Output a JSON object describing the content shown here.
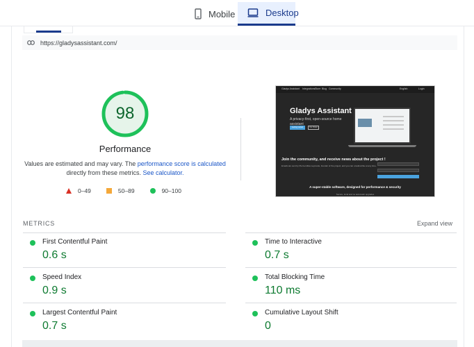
{
  "device_tabs": {
    "mobile": "Mobile",
    "desktop": "Desktop",
    "active": "desktop"
  },
  "url": "https://gladysassistant.com/",
  "score": {
    "value": 98,
    "value_fraction": 0.98,
    "label": "Performance",
    "color": "#0d652d",
    "ring_color": "#1ec15a",
    "ring_bg": "#e6f4ea"
  },
  "description": {
    "part1": "Values are estimated and may vary. The ",
    "link1": "performance score is calculated",
    "part2": " directly from these metrics. ",
    "link2": "See calculator."
  },
  "legend": [
    {
      "shape": "triangle",
      "color": "#d93025",
      "range": "0–49"
    },
    {
      "shape": "square",
      "color": "#f4a83a",
      "range": "50–89"
    },
    {
      "shape": "circle",
      "color": "#1ec15a",
      "range": "90–100"
    }
  ],
  "thumbnail": {
    "nav_brand": "Gladys Assistant",
    "nav_links": [
      "Integrations",
      "Store",
      "Blog",
      "Community"
    ],
    "nav_lang": "English",
    "nav_login": "Login",
    "hero_title": "Gladys Assistant",
    "hero_subtitle": "A privacy-first, open-source home assistant",
    "btn_primary": "Getting started",
    "btn_secondary": "Our Vision",
    "join_title": "Join the community, and receive news about the project !",
    "join_sub": "Emails are sent by Pierre-Gilles Leymarie, founder of the project, and you can unsubscribe at any time.",
    "subscribe": "Subscribe",
    "tagline": "A super-stable software, designed for performance & security",
    "footer": "Secure, local and no automatic upgrades"
  },
  "metrics": {
    "heading": "METRICS",
    "expand": "Expand view",
    "items": [
      {
        "name": "First Contentful Paint",
        "value": "0.6 s"
      },
      {
        "name": "Time to Interactive",
        "value": "0.7 s"
      },
      {
        "name": "Speed Index",
        "value": "0.9 s"
      },
      {
        "name": "Total Blocking Time",
        "value": "110 ms"
      },
      {
        "name": "Largest Contentful Paint",
        "value": "0.7 s"
      },
      {
        "name": "Cumulative Layout Shift",
        "value": "0"
      }
    ],
    "status_color": "#1ec15a"
  }
}
